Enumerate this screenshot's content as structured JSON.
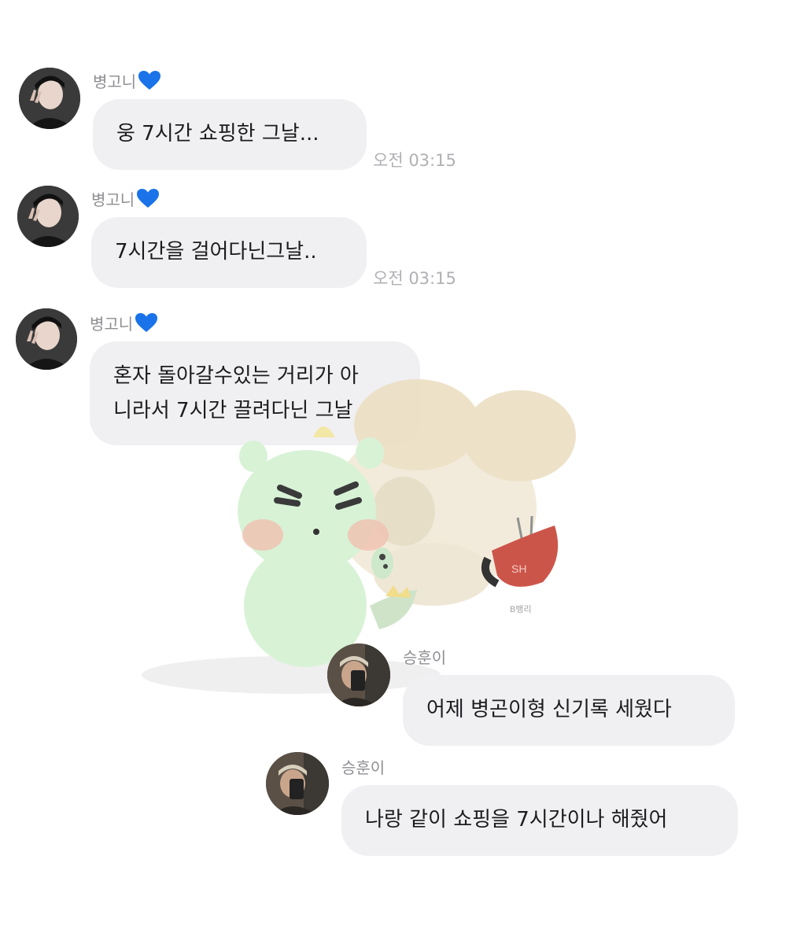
{
  "colors": {
    "bubble": "#f0f0f3",
    "sender": "#8e8e93",
    "time": "#b0b0b5",
    "heart": "#1a73e8"
  },
  "messages": [
    {
      "sender": "병고니",
      "heart": "blue-heart-icon",
      "text": "웅 7시간 쇼핑한 그날...",
      "time": "오전 03:15"
    },
    {
      "sender": "병고니",
      "heart": "blue-heart-icon",
      "text": "7시간을 걸어다닌그날..",
      "time": "오전 03:15"
    },
    {
      "sender": "병고니",
      "heart": "blue-heart-icon",
      "text_line1": "혼자 돌아갈수있는 거리가 아",
      "text_line2": "니라서 7시간 끌려다닌 그날"
    },
    {
      "sender": "승훈이",
      "text": "어제 병곤이형 신기록 세웠다"
    },
    {
      "sender": "승훈이",
      "text": "나랑 같이 쇼핑을 7시간이나 해줬어"
    }
  ],
  "sticker": {
    "signature": "B뱅리",
    "bag_text": "SH"
  }
}
